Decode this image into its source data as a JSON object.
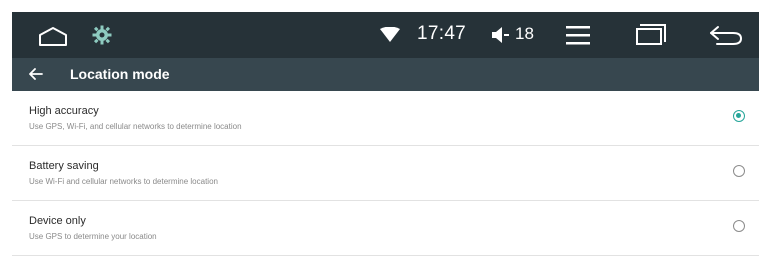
{
  "status_bar": {
    "time": "17:47",
    "volume_level": "18",
    "icons": [
      "home-icon",
      "gear-icon",
      "wifi-icon",
      "volume-icon",
      "menu-icon",
      "recent-apps-icon",
      "back-icon"
    ]
  },
  "nav_bar": {
    "title": "Location mode",
    "back_icon": "arrow-left-icon"
  },
  "options": [
    {
      "title": "High accuracy",
      "subtitle": "Use GPS, Wi-Fi, and cellular networks to determine location",
      "selected": true
    },
    {
      "title": "Battery saving",
      "subtitle": "Use Wi-Fi and cellular networks to determine location",
      "selected": false
    },
    {
      "title": "Device only",
      "subtitle": "Use GPS to determine your location",
      "selected": false
    }
  ],
  "colors": {
    "status_bar_bg": "#263238",
    "nav_bar_bg": "#37474f",
    "accent": "#26a69a",
    "gear_icon": "#8ecbc0"
  }
}
